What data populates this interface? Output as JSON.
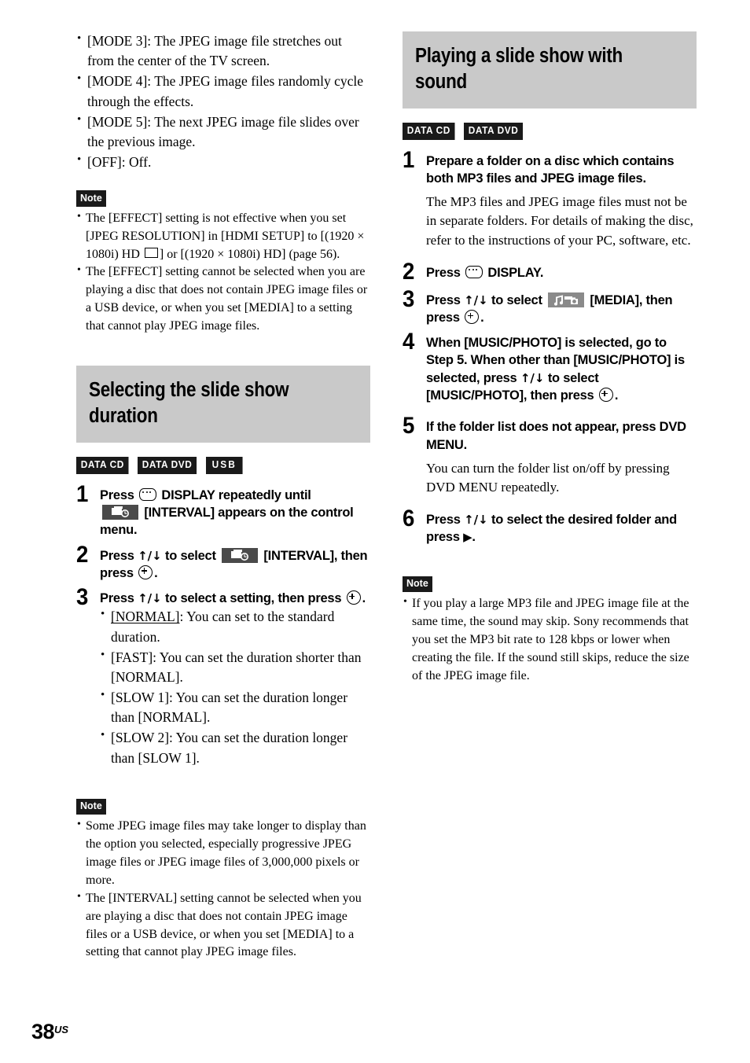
{
  "page": {
    "number": "38",
    "region": "US"
  },
  "left_column": {
    "effect_modes": [
      "[MODE 3]: The JPEG image file stretches out from the center of the TV screen.",
      "[MODE 4]: The JPEG image files randomly cycle through the effects.",
      "[MODE 5]: The next JPEG image file slides over the previous image.",
      "[OFF]: Off."
    ],
    "note_one": {
      "label": "Note",
      "items_pre_box": [
        "The [EFFECT] setting is not effective when you set [JPEG RESOLUTION] in [HDMI SETUP] to [(1920 × 1080i) HD ",
        "] or [(1920 × 1080i) HD] (page 56)."
      ],
      "item_two": "The [EFFECT] setting cannot be selected when you are playing a disc that does not contain JPEG image files or a USB device, or when you set [MEDIA] to a setting that cannot play JPEG image files."
    },
    "heading": "Selecting the slide show duration",
    "badges": [
      "DATA CD",
      "DATA DVD",
      "USB"
    ],
    "steps": {
      "one_num": "1",
      "one_part_a": "Press",
      "one_part_b": "DISPLAY repeatedly until",
      "one_part_c": "[INTERVAL] appears on the control menu.",
      "two_num": "2",
      "two_part_a": "Press",
      "two_arrows": "↑/↓",
      "two_part_b": "to select",
      "two_part_c": "[INTERVAL], then press",
      "two_part_d": ".",
      "three_num": "3",
      "three_part_a": "Press",
      "three_arrows": "↑/↓",
      "three_part_b": "to select a setting, then press",
      "three_part_c": "."
    },
    "settings": [
      {
        "name": "[NORMAL]",
        "underlined": true,
        "text": ": You can set to the standard duration."
      },
      {
        "name": "[FAST]",
        "underlined": false,
        "text": ": You can set the duration shorter than [NORMAL]."
      },
      {
        "name": "[SLOW 1]",
        "underlined": false,
        "text": ": You can set the duration longer than [NORMAL]."
      },
      {
        "name": "[SLOW 2]",
        "underlined": false,
        "text": ": You can set the duration longer than [SLOW 1]."
      }
    ],
    "note_two": {
      "label": "Note",
      "items": [
        "Some JPEG image files may take longer to display than the option you selected, especially progressive JPEG image files or JPEG image files of 3,000,000 pixels or more.",
        "The [INTERVAL] setting cannot be selected when you are playing a disc that does not contain JPEG image files or a USB device, or when you set [MEDIA] to a setting that cannot play JPEG image files."
      ]
    }
  },
  "right_column": {
    "heading": "Playing a slide show with sound",
    "badges": [
      "DATA CD",
      "DATA DVD"
    ],
    "steps": {
      "one_num": "1",
      "one_title": "Prepare a folder on a disc which contains both MP3 files and JPEG image files.",
      "one_desc": "The MP3 files and JPEG image files must not be in separate folders. For details of making the disc, refer to the instructions of your PC, software, etc.",
      "two_num": "2",
      "two_part_a": "Press",
      "two_part_b": "DISPLAY.",
      "three_num": "3",
      "three_part_a": "Press",
      "three_arrows": "↑/↓",
      "three_part_b": "to select",
      "three_part_c": "[MEDIA], then press",
      "three_part_d": ".",
      "four_num": "4",
      "four_part_a": "When [MUSIC/PHOTO] is selected, go to Step 5. When other than [MUSIC/PHOTO] is selected, press",
      "four_arrows": "↑/↓",
      "four_part_b": "to select [MUSIC/PHOTO], then press",
      "four_part_c": ".",
      "five_num": "5",
      "five_title": "If the folder list does not appear, press DVD MENU.",
      "five_desc": "You can turn the folder list on/off by pressing DVD MENU repeatedly.",
      "six_num": "6",
      "six_part_a": "Press",
      "six_arrows": "↑/↓",
      "six_part_b": "to select the desired folder and press",
      "six_play": "▶",
      "six_part_c": "."
    },
    "note": {
      "label": "Note",
      "items": [
        "If you play a large MP3 file and JPEG image file at the same time, the sound may skip. Sony recommends that you set the MP3 bit rate to 128 kbps or lower when creating the file. If the sound still skips, reduce the size of the JPEG image file."
      ]
    }
  },
  "colors": {
    "heading_band": "#c9c9c9",
    "badge_bg": "#1a1a1a",
    "interval_icon_bg": "#4a4a4a",
    "media_icon_bg": "#8a8a8a"
  }
}
